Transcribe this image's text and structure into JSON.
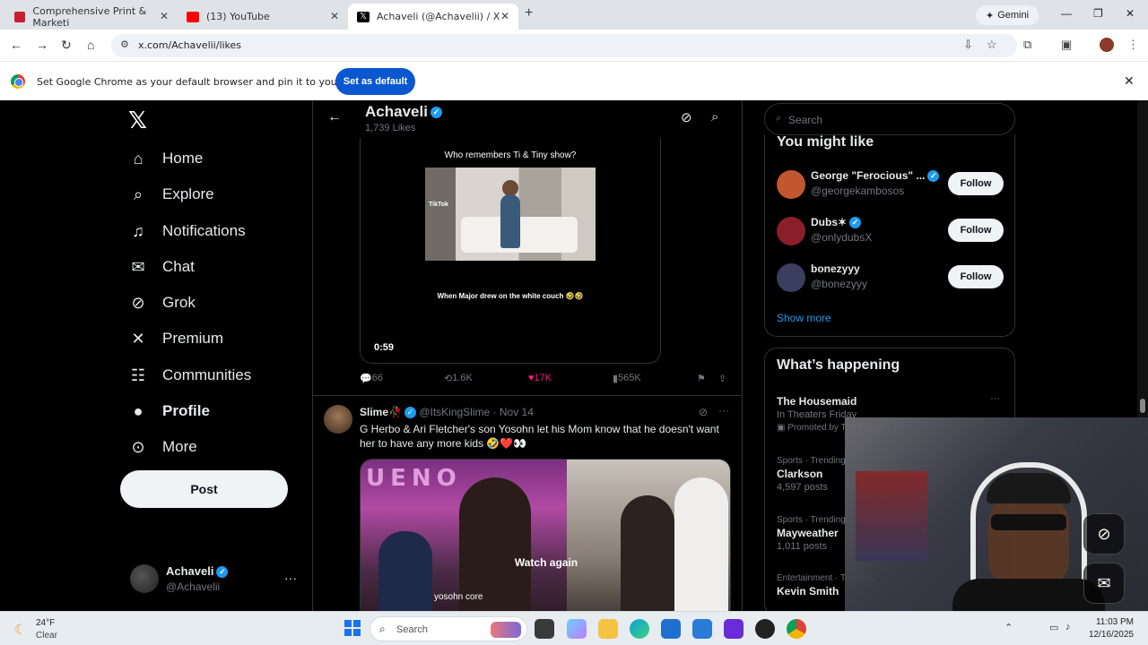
{
  "browser": {
    "tabs": [
      {
        "title": "Comprehensive Print & Marketi",
        "color": "#c8202f"
      },
      {
        "title": "(13) YouTube",
        "color": "#ff0000"
      },
      {
        "title": "Achaveli (@Achavelii) / X",
        "color": "#000000"
      }
    ],
    "gemini_label": "Gemini",
    "url": "x.com/Achavelii/likes",
    "infobar_message": "Set Google Chrome as your default browser and pin it to your taskbar",
    "infobar_button": "Set as default"
  },
  "sidebar": {
    "items": [
      {
        "label": "Home",
        "icon": "home-icon"
      },
      {
        "label": "Explore",
        "icon": "search-icon"
      },
      {
        "label": "Notifications",
        "icon": "bell-icon"
      },
      {
        "label": "Chat",
        "icon": "mail-icon"
      },
      {
        "label": "Grok",
        "icon": "grok-icon"
      },
      {
        "label": "Premium",
        "icon": "x-icon"
      },
      {
        "label": "Communities",
        "icon": "people-icon"
      },
      {
        "label": "Profile",
        "icon": "person-icon"
      },
      {
        "label": "More",
        "icon": "more-circle-icon"
      }
    ],
    "post_label": "Post",
    "account": {
      "name": "Achaveli",
      "handle": "@Achavelii"
    }
  },
  "header": {
    "title": "Achaveli",
    "subtitle": "1,739 Likes"
  },
  "tweet1": {
    "caption_top": "Who remembers Ti & Tiny show?",
    "caption_bottom": "When Major drew on the white couch 🤣🤣",
    "watermark": "TikTok",
    "duration": "0:59",
    "replies": "66",
    "reposts": "1.6K",
    "likes": "17K",
    "views": "565K"
  },
  "tweet2": {
    "name": "Slime🥀",
    "handle": "@ItsKingSlime",
    "date": "· Nov 14",
    "text": "G Herbo & Ari Fletcher's son Yosohn let his Mom know that he doesn't want her to have any more kids 🤣❤️👀",
    "neon": "UENO",
    "overlay": "Watch again",
    "caption": "yosohn core"
  },
  "right": {
    "search_placeholder": "Search",
    "wtf_title": "You might like",
    "suggestions": [
      {
        "name": "George \"Ferocious\" ...",
        "handle": "@georgekambosos",
        "follow": "Follow",
        "avatar": "#c2572d"
      },
      {
        "name": "Dubs✶",
        "handle": "@onlydubsX",
        "follow": "Follow",
        "avatar": "#8a1f2a"
      },
      {
        "name": "bonezyyy",
        "handle": "@bonezyyy",
        "follow": "Follow",
        "avatar": "#3a3f60"
      }
    ],
    "show_more": "Show more",
    "happening_title": "What’s happening",
    "trends": [
      {
        "meta": "",
        "name": "The Housemaid",
        "sub": "In Theaters Friday",
        "extra": "Promoted by The Housemaid"
      },
      {
        "meta": "Sports · Trending",
        "name": "Clarkson",
        "sub": "4,597 posts",
        "extra": ""
      },
      {
        "meta": "Sports · Trending",
        "name": "Mayweather",
        "sub": "1,011 posts",
        "extra": ""
      },
      {
        "meta": "Entertainment · Trending",
        "name": "Kevin Smith",
        "sub": "",
        "extra": ""
      }
    ]
  },
  "taskbar": {
    "temp": "24°F",
    "condition": "Clear",
    "search_placeholder": "Search",
    "time": "11:03 PM",
    "date": "12/16/2025"
  }
}
